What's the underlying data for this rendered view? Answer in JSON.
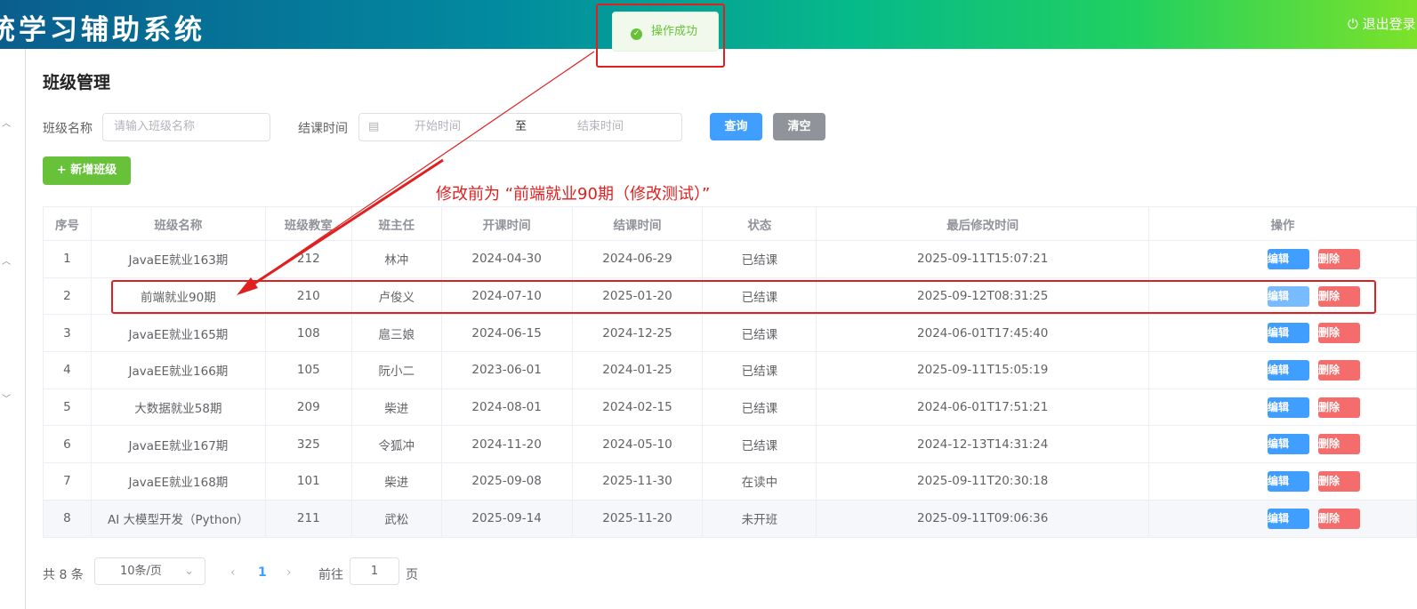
{
  "header": {
    "title": "统学习辅助系统",
    "logout": "退出登录"
  },
  "toast": {
    "message": "操作成功"
  },
  "page": {
    "title": "班级管理"
  },
  "search": {
    "name_label": "班级名称",
    "name_placeholder": "请输入班级名称",
    "end_label": "结课时间",
    "start_placeholder": "开始时间",
    "sep": "至",
    "end_placeholder": "结束时间",
    "query": "查询",
    "clear": "清空"
  },
  "add_button": "+ 新增班级",
  "annotation": "修改前为 “前端就业90期（修改测试）”",
  "table": {
    "headers": [
      "序号",
      "班级名称",
      "班级教室",
      "班主任",
      "开课时间",
      "结课时间",
      "状态",
      "最后修改时间",
      "操作"
    ],
    "edit": "编辑",
    "delete": "删除",
    "rows": [
      [
        "1",
        "JavaEE就业163期",
        "212",
        "林冲",
        "2024-04-30",
        "2024-06-29",
        "已结课",
        "2025-09-11T15:07:21"
      ],
      [
        "2",
        "前端就业90期",
        "210",
        "卢俊义",
        "2024-07-10",
        "2025-01-20",
        "已结课",
        "2025-09-12T08:31:25"
      ],
      [
        "3",
        "JavaEE就业165期",
        "108",
        "扈三娘",
        "2024-06-15",
        "2024-12-25",
        "已结课",
        "2024-06-01T17:45:40"
      ],
      [
        "4",
        "JavaEE就业166期",
        "105",
        "阮小二",
        "2023-06-01",
        "2024-01-25",
        "已结课",
        "2025-09-11T15:05:19"
      ],
      [
        "5",
        "大数据就业58期",
        "209",
        "柴进",
        "2024-08-01",
        "2024-02-15",
        "已结课",
        "2024-06-01T17:51:21"
      ],
      [
        "6",
        "JavaEE就业167期",
        "325",
        "令狐冲",
        "2024-11-20",
        "2024-05-10",
        "已结课",
        "2024-12-13T14:31:24"
      ],
      [
        "7",
        "JavaEE就业168期",
        "101",
        "柴进",
        "2025-09-08",
        "2025-11-30",
        "在读中",
        "2025-09-11T20:30:18"
      ],
      [
        "8",
        "AI 大模型开发（Python）",
        "211",
        "武松",
        "2025-09-14",
        "2025-11-20",
        "未开班",
        "2025-09-11T09:06:36"
      ]
    ]
  },
  "pagination": {
    "total": "共 8 条",
    "page_size": "10条/页",
    "current": "1",
    "goto": "前往",
    "goto_value": "1",
    "page_unit": "页"
  }
}
